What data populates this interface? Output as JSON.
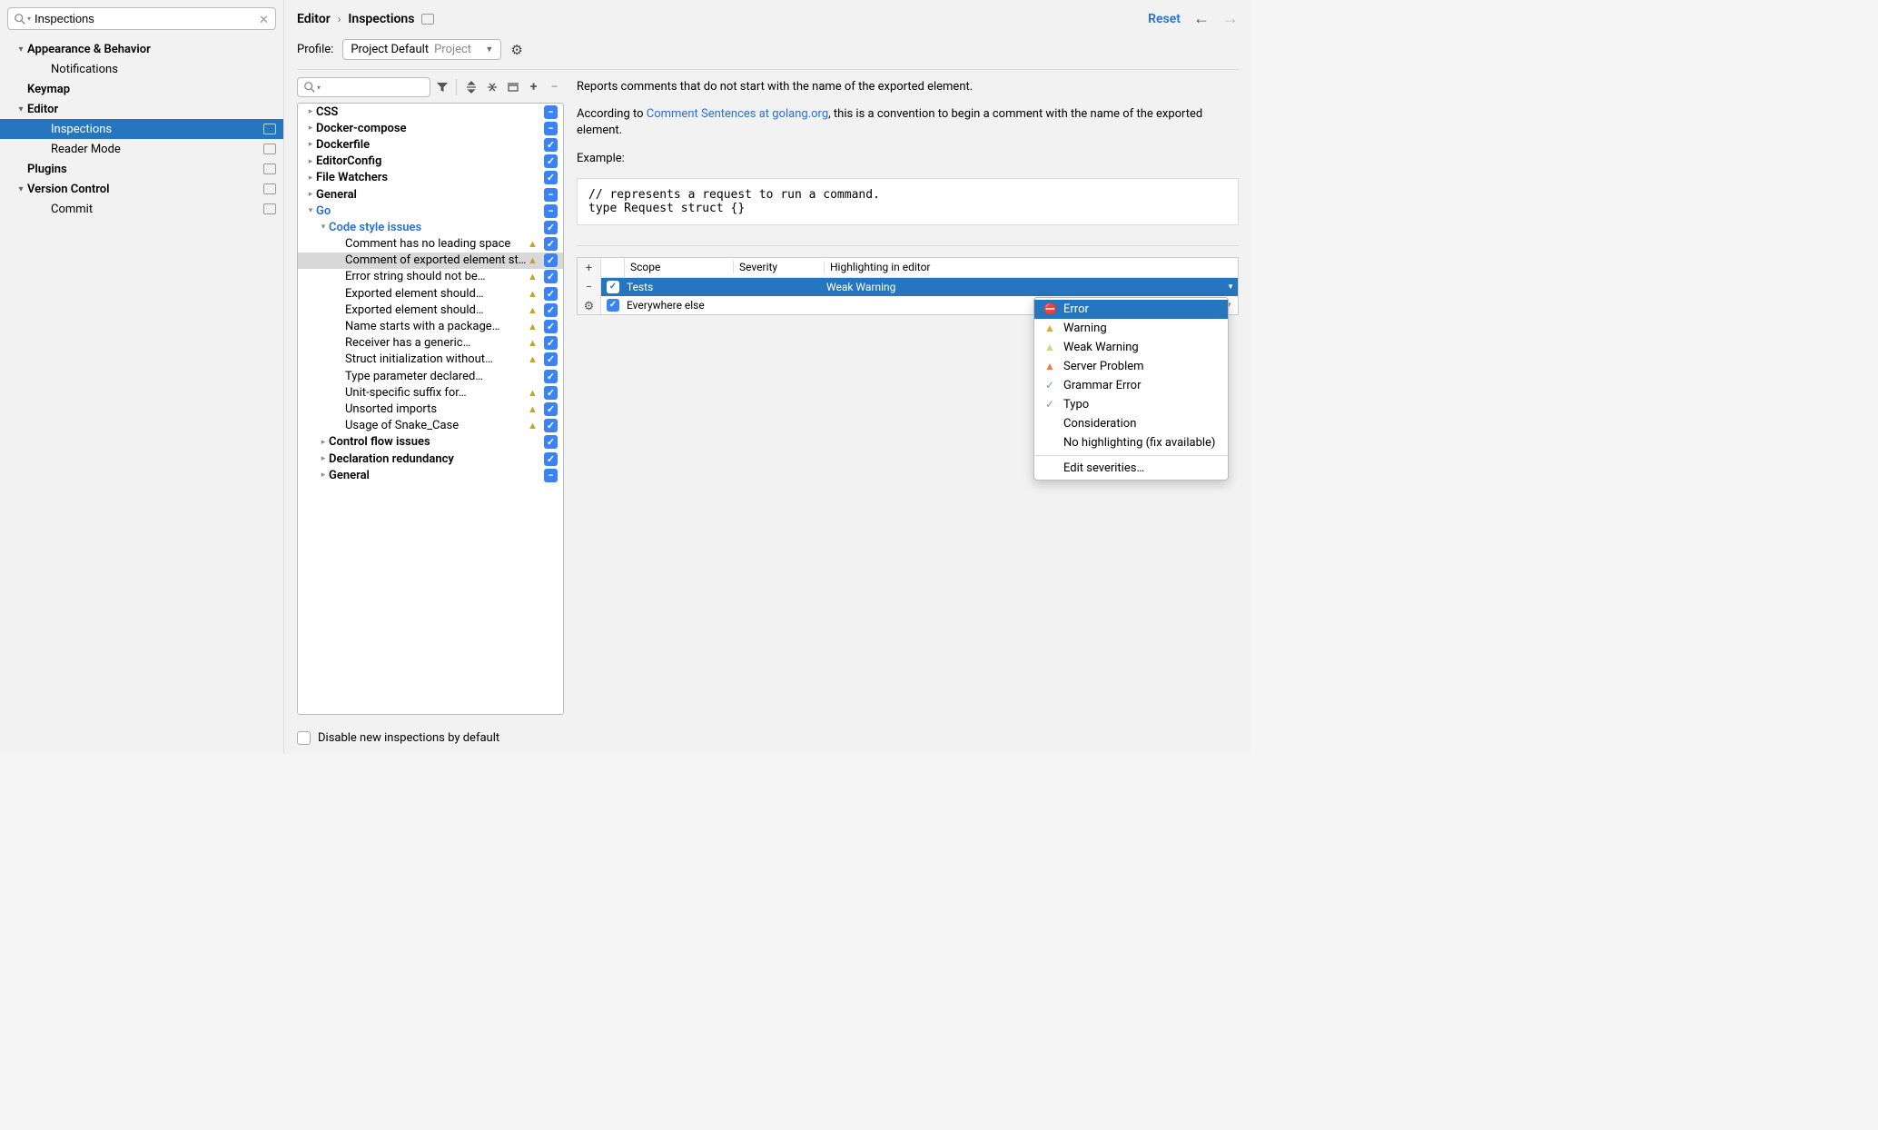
{
  "sidebar": {
    "search_value": "Inspections",
    "items": [
      {
        "label": "Appearance & Behavior",
        "bold": true,
        "chevron": "▾",
        "pad": 1,
        "badge": false
      },
      {
        "label": "Notifications",
        "bold": false,
        "pad": 2,
        "badge": false
      },
      {
        "label": "Keymap",
        "bold": true,
        "pad": 1,
        "badge": false
      },
      {
        "label": "Editor",
        "bold": true,
        "chevron": "▾",
        "pad": 1,
        "badge": false
      },
      {
        "label": "Inspections",
        "bold": false,
        "pad": 2,
        "badge": true,
        "selected": true
      },
      {
        "label": "Reader Mode",
        "bold": false,
        "pad": 2,
        "badge": true
      },
      {
        "label": "Plugins",
        "bold": true,
        "pad": 1,
        "badge": true
      },
      {
        "label": "Version Control",
        "bold": true,
        "chevron": "▾",
        "pad": 1,
        "badge": true
      },
      {
        "label": "Commit",
        "bold": false,
        "pad": 2,
        "badge": true
      }
    ]
  },
  "breadcrumb": {
    "parent": "Editor",
    "current": "Inspections",
    "reset": "Reset"
  },
  "profile": {
    "label": "Profile:",
    "name": "Project Default",
    "scope": "Project"
  },
  "inspections_tree": [
    {
      "label": "CSS",
      "bold": true,
      "check": "minus",
      "chev": "▸",
      "pad": 0
    },
    {
      "label": "Docker-compose",
      "bold": true,
      "check": "minus",
      "chev": "▸",
      "pad": 0
    },
    {
      "label": "Dockerfile",
      "bold": true,
      "check": "check",
      "chev": "▸",
      "pad": 0
    },
    {
      "label": "EditorConfig",
      "bold": true,
      "check": "check",
      "chev": "▸",
      "pad": 0
    },
    {
      "label": "File Watchers",
      "bold": true,
      "check": "check",
      "chev": "▸",
      "pad": 0
    },
    {
      "label": "General",
      "bold": true,
      "check": "minus",
      "chev": "▸",
      "pad": 0
    },
    {
      "label": "Go",
      "link": true,
      "check": "minus",
      "chev": "▾",
      "pad": 0
    },
    {
      "label": "Code style issues",
      "link": true,
      "check": "check",
      "chev": "▾",
      "pad": 1
    },
    {
      "label": "Comment has no leading space",
      "check": "check",
      "pad": 2,
      "warn": true
    },
    {
      "label": "Comment of exported element starts with...",
      "check": "check",
      "pad": 2,
      "warn": true,
      "selected": true
    },
    {
      "label": "Error string should not be…",
      "check": "check",
      "pad": 2,
      "warn": true
    },
    {
      "label": "Exported element should…",
      "check": "check",
      "pad": 2,
      "warn": true
    },
    {
      "label": "Exported element should…",
      "check": "check",
      "pad": 2,
      "warn": true
    },
    {
      "label": "Name starts with a package…",
      "check": "check",
      "pad": 2,
      "warn": true
    },
    {
      "label": "Receiver has a generic…",
      "check": "check",
      "pad": 2,
      "warn": true
    },
    {
      "label": "Struct initialization without…",
      "check": "check",
      "pad": 2,
      "warn": true
    },
    {
      "label": "Type parameter declared…",
      "check": "check",
      "pad": 2
    },
    {
      "label": "Unit-specific suffix for…",
      "check": "check",
      "pad": 2,
      "warn": true
    },
    {
      "label": "Unsorted imports",
      "check": "check",
      "pad": 2,
      "warn": true
    },
    {
      "label": "Usage of Snake_Case",
      "check": "check",
      "pad": 2,
      "warn": true
    },
    {
      "label": "Control flow issues",
      "bold": true,
      "check": "check",
      "chev": "▸",
      "pad": 1
    },
    {
      "label": "Declaration redundancy",
      "bold": true,
      "check": "check",
      "chev": "▸",
      "pad": 1
    },
    {
      "label": "General",
      "bold": true,
      "check": "minus",
      "chev": "▸",
      "pad": 1
    }
  ],
  "disable_label": "Disable new inspections by default",
  "description": {
    "p1": "Reports comments that do not start with the name of the exported element.",
    "p2a": "According to ",
    "link": "Comment Sentences at golang.org",
    "p2b": ", this is a convention to begin a comment with the name of the exported element.",
    "example_label": "Example:",
    "code": "// represents a request to run a command.\ntype Request struct {}"
  },
  "scope_table": {
    "headers": {
      "scope": "Scope",
      "severity": "Severity",
      "highlighting": "Highlighting in editor"
    },
    "rows": [
      {
        "scope": "Tests",
        "hl": "Weak Warning",
        "selected": true
      },
      {
        "scope": "Everywhere else",
        "hl": ""
      }
    ]
  },
  "dropdown": {
    "items": [
      {
        "label": "Error",
        "icon": "error",
        "selected": true
      },
      {
        "label": "Warning",
        "icon": "warn1"
      },
      {
        "label": "Weak Warning",
        "icon": "warn2"
      },
      {
        "label": "Server Problem",
        "icon": "server"
      },
      {
        "label": "Grammar Error",
        "icon": "grammar"
      },
      {
        "label": "Typo",
        "icon": "typo"
      },
      {
        "label": "Consideration"
      },
      {
        "label": "No highlighting (fix available)"
      }
    ],
    "edit": "Edit severities…"
  }
}
